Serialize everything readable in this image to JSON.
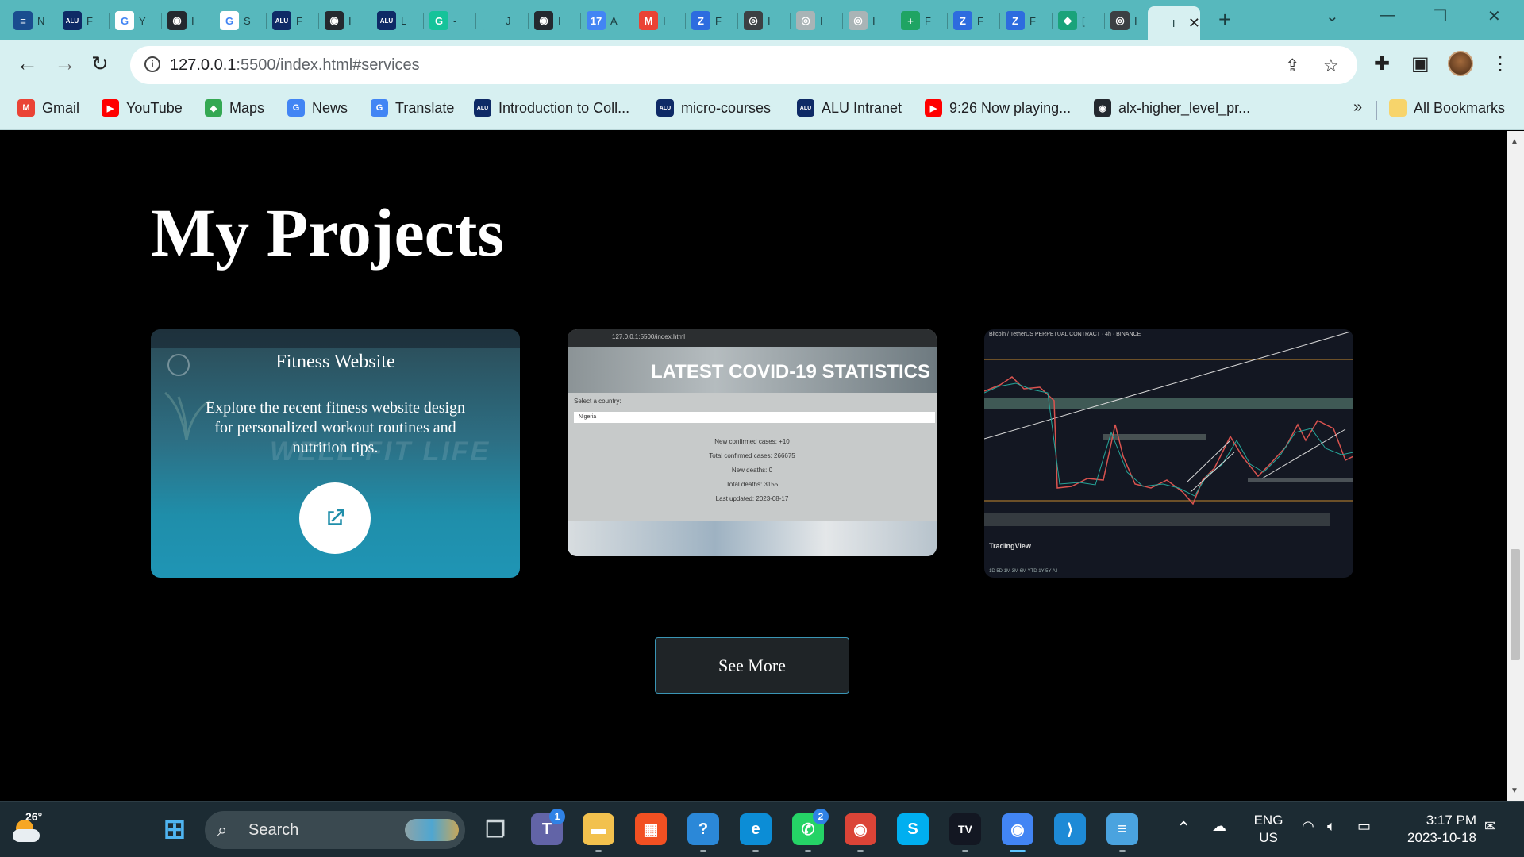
{
  "browser": {
    "tabs": [
      {
        "title": "N",
        "color": "#1a4d8f",
        "glyph": "≡"
      },
      {
        "title": "F",
        "color": "#0e2a66",
        "glyph": "ALU"
      },
      {
        "title": "Y",
        "color": "#ffffff",
        "glyph": "G"
      },
      {
        "title": "I",
        "color": "#24292f",
        "glyph": "◉"
      },
      {
        "title": "S",
        "color": "#ffffff",
        "glyph": "G"
      },
      {
        "title": "F",
        "color": "#0e2a66",
        "glyph": "ALU"
      },
      {
        "title": "I",
        "color": "#24292f",
        "glyph": "◉"
      },
      {
        "title": "L",
        "color": "#0e2a66",
        "glyph": "ALU"
      },
      {
        "title": "-",
        "color": "#15c39a",
        "glyph": "G"
      },
      {
        "title": "J",
        "color": "#57b8bd",
        "glyph": ""
      },
      {
        "title": "I",
        "color": "#24292f",
        "glyph": "◉"
      },
      {
        "title": "A",
        "color": "#4285f4",
        "glyph": "17"
      },
      {
        "title": "I",
        "color": "#ea4335",
        "glyph": "M"
      },
      {
        "title": "F",
        "color": "#2d6cdf",
        "glyph": "Z"
      },
      {
        "title": "I",
        "color": "#3c4043",
        "glyph": "◎"
      },
      {
        "title": "I",
        "color": "#a9b4b6",
        "glyph": "◎"
      },
      {
        "title": "I",
        "color": "#a9b4b6",
        "glyph": "◎"
      },
      {
        "title": "F",
        "color": "#1fa463",
        "glyph": "+"
      },
      {
        "title": "F",
        "color": "#2d6cdf",
        "glyph": "Z"
      },
      {
        "title": "F",
        "color": "#2d6cdf",
        "glyph": "Z"
      },
      {
        "title": "[",
        "color": "#1aa37a",
        "glyph": "◆"
      },
      {
        "title": "I",
        "color": "#3c4043",
        "glyph": "◎"
      },
      {
        "title": "I",
        "color": "#d7f0f1",
        "glyph": ""
      }
    ],
    "url_host": "127.0.0.1",
    "url_rest": ":5500/index.html#services",
    "bookmarks": [
      {
        "label": "Gmail",
        "color": "#ea4335",
        "glyph": "M"
      },
      {
        "label": "YouTube",
        "color": "#ff0000",
        "glyph": "▶"
      },
      {
        "label": "Maps",
        "color": "#34a853",
        "glyph": "◆"
      },
      {
        "label": "News",
        "color": "#4285f4",
        "glyph": "G"
      },
      {
        "label": "Translate",
        "color": "#4285f4",
        "glyph": "G"
      },
      {
        "label": "Introduction to Coll...",
        "color": "#0e2a66",
        "glyph": "ALU"
      },
      {
        "label": "micro-courses",
        "color": "#0e2a66",
        "glyph": "ALU"
      },
      {
        "label": "ALU Intranet",
        "color": "#0e2a66",
        "glyph": "ALU"
      },
      {
        "label": "9:26 Now playing...",
        "color": "#ff0000",
        "glyph": "▶"
      },
      {
        "label": "alx-higher_level_pr...",
        "color": "#24292f",
        "glyph": "◉"
      }
    ],
    "bookmarks_more": "»",
    "all_bookmarks": "All Bookmarks"
  },
  "page": {
    "heading": "My Projects",
    "projects": [
      {
        "title": "Fitness Website",
        "description": "Explore the recent fitness website design for personalized workout routines and nutrition tips.",
        "ghost_text": "WELL FIT LIFE"
      },
      {
        "headline": "LATEST COVID-19 STATISTICS",
        "mini_url": "127.0.0.1:5500/index.html",
        "select_label": "Select a country:",
        "selected_country": "Nigeria",
        "stats": [
          "New confirmed cases: +10",
          "Total confirmed cases: 266675",
          "New deaths: 0",
          "Total deaths: 3155",
          "Last updated: 2023-08-17"
        ]
      },
      {
        "header": "Bitcoin / TetherUS PERPETUAL CONTRACT · 4h · BINANCE",
        "logo": "TradingView",
        "timeframes": "1D  5D  1M  3M  6M  YTD  1Y  5Y  All"
      }
    ],
    "see_more": "See More"
  },
  "taskbar": {
    "temperature": "26°",
    "search": "Search",
    "teams_badge": "1",
    "whatsapp_badge": "2",
    "language_line1": "ENG",
    "language_line2": "US",
    "time": "3:17 PM",
    "date": "2023-10-18",
    "apps": [
      {
        "name": "start",
        "glyph": "⊞",
        "color": "#4fb5f2"
      },
      {
        "name": "taskview",
        "glyph": "❐",
        "color": "#cfd8dc"
      },
      {
        "name": "teams",
        "glyph": "T",
        "color": "#6264a7"
      },
      {
        "name": "explorer",
        "glyph": "▬",
        "color": "#f2c14e"
      },
      {
        "name": "store",
        "glyph": "▦",
        "color": "#f25022"
      },
      {
        "name": "help",
        "glyph": "?",
        "color": "#2b88d8"
      },
      {
        "name": "edge",
        "glyph": "e",
        "color": "#0c8dd6"
      },
      {
        "name": "whatsapp",
        "glyph": "✆",
        "color": "#25d366"
      },
      {
        "name": "chrome-profile",
        "glyph": "◉",
        "color": "#db4437"
      },
      {
        "name": "skype",
        "glyph": "S",
        "color": "#00aff0"
      },
      {
        "name": "tradingview",
        "glyph": "TV",
        "color": "#131722"
      },
      {
        "name": "chrome",
        "glyph": "◉",
        "color": "#4285f4"
      },
      {
        "name": "vscode",
        "glyph": "⟩",
        "color": "#1e8ad6"
      },
      {
        "name": "notepad",
        "glyph": "≡",
        "color": "#4aa3df"
      }
    ]
  }
}
